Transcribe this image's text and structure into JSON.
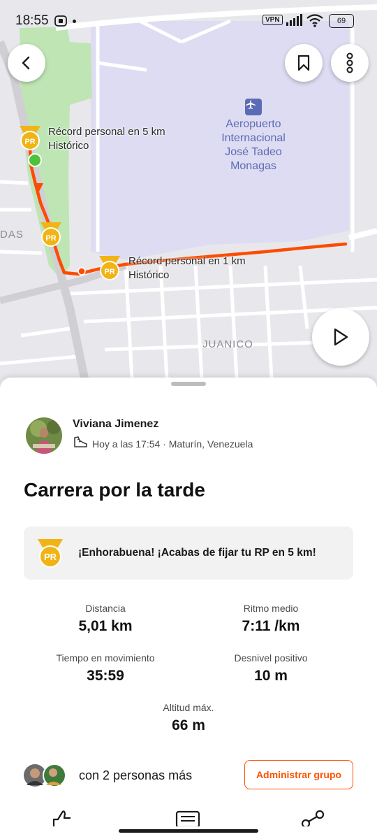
{
  "status_bar": {
    "time": "18:55",
    "vpn": "VPN",
    "battery": "69"
  },
  "map": {
    "pr_label_5k_line1": "Récord personal en 5 km",
    "pr_label_5k_line2": "Histórico",
    "pr_label_1k_line1": "Récord personal en 1 km",
    "pr_label_1k_line2": "Histórico",
    "airport_line1": "Aeropuerto",
    "airport_line2": "Internacional",
    "airport_line3": "José Tadeo",
    "airport_line4": "Monagas",
    "district_juanico": "JUANICO",
    "district_das": "DAS",
    "pr_badge_text": "PR",
    "route_color": "#fc4c02",
    "start_color": "#4cc43a"
  },
  "activity": {
    "athlete_name": "Viviana Jimenez",
    "meta": "Hoy a las 17:54 · Maturín, Venezuela",
    "title": "Carrera por la tarde",
    "pr_banner": "¡Enhorabuena! ¡Acabas de fijar tu RP en 5 km!",
    "stats": [
      {
        "label": "Distancia",
        "value": "5,01 km"
      },
      {
        "label": "Ritmo medio",
        "value": "7:11 /km"
      },
      {
        "label": "Tiempo en movimiento",
        "value": "35:59"
      },
      {
        "label": "Desnivel positivo",
        "value": "10 m"
      },
      {
        "label": "Altitud máx.",
        "value": "66 m"
      }
    ],
    "group_text": "con 2 personas más",
    "group_button": "Administrar grupo",
    "accent": "#fc5200"
  }
}
